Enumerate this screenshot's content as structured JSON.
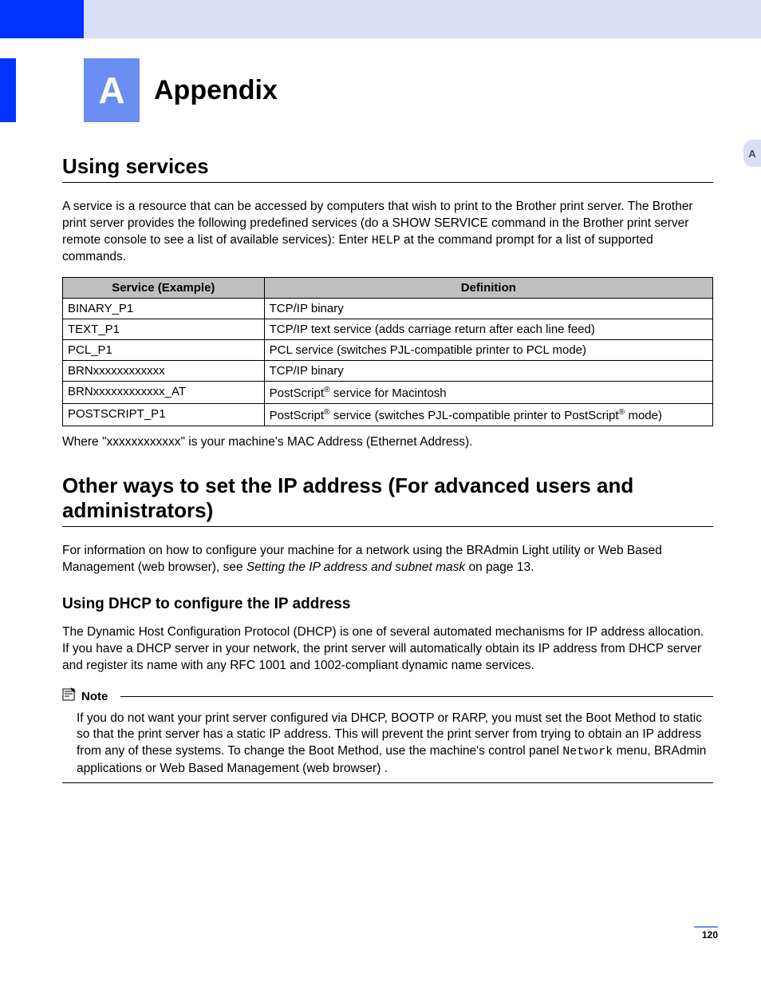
{
  "header": {
    "letter": "A",
    "title": "Appendix",
    "side_tab": "A"
  },
  "section1": {
    "heading": "Using services",
    "para_pre": "A service is a resource that can be accessed by computers that wish to print to the Brother print server. The Brother print server provides the following predefined services (do a SHOW SERVICE command in the Brother print server remote console to see a list of available services): Enter ",
    "para_code": "HELP",
    "para_post": " at the command prompt for a list of supported commands.",
    "table": {
      "col1": "Service (Example)",
      "col2": "Definition",
      "rows": [
        {
          "svc": "BINARY_P1",
          "def": "TCP/IP binary"
        },
        {
          "svc": "TEXT_P1",
          "def": "TCP/IP text service (adds carriage return after each line feed)"
        },
        {
          "svc": "PCL_P1",
          "def": "PCL service (switches PJL-compatible printer to PCL mode)"
        },
        {
          "svc": "BRNxxxxxxxxxxxx",
          "def": "TCP/IP binary"
        },
        {
          "svc": "BRNxxxxxxxxxxxx_AT",
          "def_html": "PostScript<sup>®</sup> service for Macintosh"
        },
        {
          "svc": "POSTSCRIPT_P1",
          "def_html": "PostScript<sup>®</sup> service (switches PJL-compatible printer to PostScript<sup>®</sup> mode)"
        }
      ]
    },
    "footnote": "Where \"xxxxxxxxxxxx\" is your machine's MAC Address (Ethernet Address)."
  },
  "section2": {
    "heading": "Other ways to set the IP address (For advanced users and administrators)",
    "para_pre": "For information on how to configure your machine for a network using the BRAdmin Light utility or Web Based Management (web browser), see ",
    "para_link": "Setting the IP address and subnet mask",
    "para_post": " on page 13."
  },
  "section3": {
    "heading": "Using DHCP to configure the IP address",
    "para": "The Dynamic Host Configuration Protocol (DHCP) is one of several automated mechanisms for IP address allocation. If you have a DHCP server in your network, the print server will automatically obtain its IP address from DHCP server and register its name with any RFC 1001 and 1002-compliant dynamic name services."
  },
  "note": {
    "label": "Note",
    "body_pre": "If you do not want your print server configured via DHCP, BOOTP or RARP, you must set the Boot Method to static so that the print server has a static IP address. This will prevent the print server from trying to obtain an IP address from any of these systems. To change the Boot Method, use the machine's control panel ",
    "body_code": "Network",
    "body_post": " menu, BRAdmin applications or Web Based Management (web browser) ."
  },
  "page_number": "120"
}
